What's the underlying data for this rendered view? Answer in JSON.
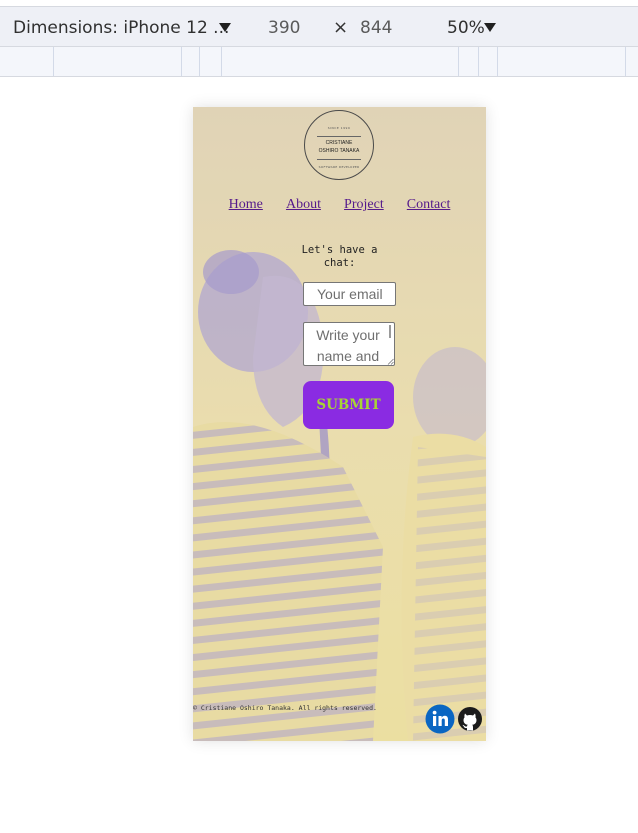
{
  "devtools": {
    "dimensions_label": "Dimensions: iPhone 12 ...",
    "width": "390",
    "times": "×",
    "height": "844",
    "zoom": "50%",
    "icons": [
      "dropdown-triangle-icon"
    ]
  },
  "site": {
    "logo": {
      "top_text": "SINCE 1999",
      "name_line1": "CRISTIANE",
      "name_line2": "OSHIRO TANAKA",
      "bottom_text": "SOFTWARE DEVELOPER"
    },
    "nav": {
      "home": "Home",
      "about": "About",
      "project": "Project",
      "contact": "Contact"
    },
    "form": {
      "title_line1": "Let's have a",
      "title_line2": "chat:",
      "email_placeholder": "Your email",
      "message_placeholder": "Write your name and message",
      "submit_label": "SUBMIT"
    },
    "footer": {
      "copyright": "© Cristiane Oshiro Tanaka. All rights reserved.",
      "icons": [
        "linkedin-icon",
        "github-icon"
      ]
    },
    "colors": {
      "background_tint": "#e6dcb7",
      "photo_overlay": "#9f95d6",
      "link": "#551a8b",
      "submit_bg": "#8a2be2",
      "submit_text": "#a7d336",
      "linkedin": "#0a66c2"
    }
  }
}
